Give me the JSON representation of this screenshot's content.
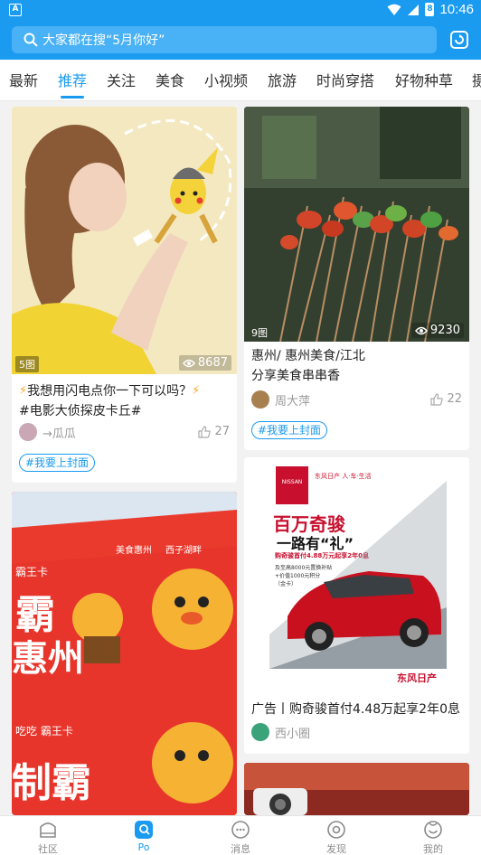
{
  "status": {
    "time": "10:46",
    "battery": "8",
    "app_icon": "A"
  },
  "search": {
    "placeholder": "大家都在搜“5月你好”"
  },
  "tabs": [
    "最新",
    "推荐",
    "关注",
    "美食",
    "小视频",
    "旅游",
    "时尚穿搭",
    "好物种草",
    "摄"
  ],
  "active_tab": "推荐",
  "feed": {
    "card1": {
      "img_count": "5图",
      "views": "8687",
      "title_line1": "我想用闪电点你一下可以吗？",
      "title_line2": "#电影大侦探皮卡丘#",
      "author": "→瓜瓜",
      "likes": "27",
      "tag": "#我要上封面"
    },
    "card2": {
      "img_count": "9图",
      "views": "9230",
      "title_line1": "惠州/ 惠州美食/江北",
      "title_line2": "分享美食串串香⁠",
      "author": "周大萍",
      "likes": "22",
      "tag": "#我要上封面"
    },
    "card3": {
      "img_text_small1": "美食惠州",
      "img_text_small2": "西子湖畔",
      "img_text_card": "霸王卡",
      "img_text_big1": "霸",
      "img_text_big2": "惠州",
      "img_text_big3": "制霸",
      "img_text_mid": "吃吃 霸王卡"
    },
    "card4": {
      "ad_headline1": "百万奇骏",
      "ad_headline2": "一路有“礼”",
      "ad_offer": "购奇骏首付4.88万元起享2年0息",
      "ad_sub1": "及至高8000元置换补贴",
      "ad_sub2": "+价值1000元积分",
      "ad_sub3": "（金卡）",
      "ad_brand_top": "东风日产 人·车·生活",
      "ad_brand_logo": "NISSAN",
      "ad_footer_brand": "东风日产",
      "title": "广告丨购奇骏首付4.48万起享2年0息",
      "author": "西小圈"
    }
  },
  "bottom_nav": [
    "社区",
    "Po",
    "消息",
    "发现",
    "我的"
  ],
  "active_nav": "Po",
  "colors": {
    "accent": "#1a9bf0",
    "text": "#222222",
    "muted": "#999999"
  }
}
